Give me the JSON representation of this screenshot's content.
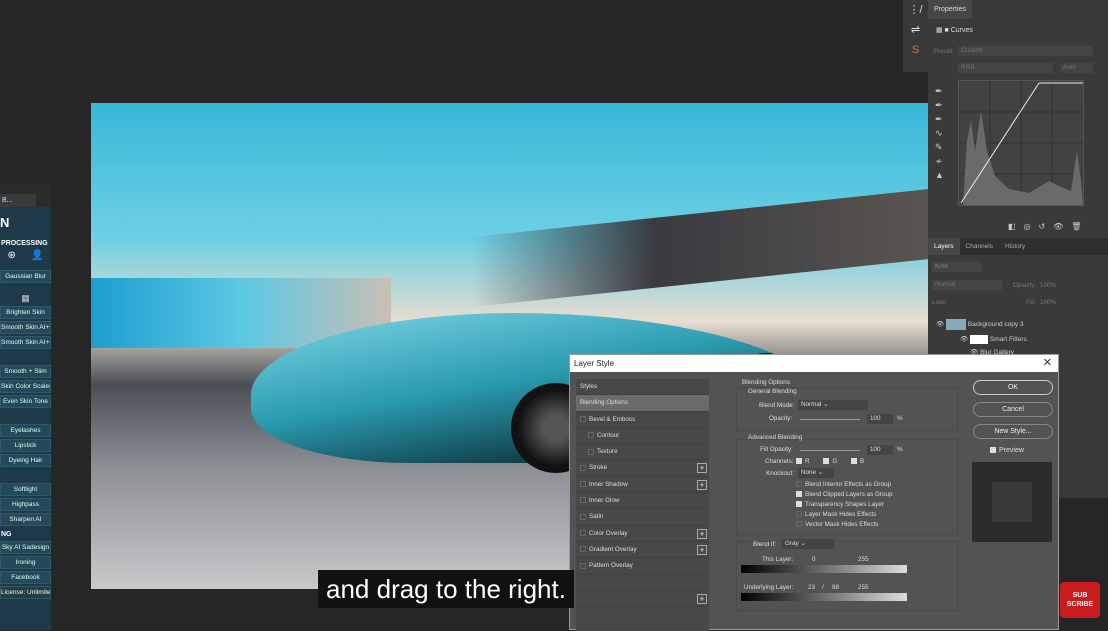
{
  "left_panel": {
    "tab": "B...",
    "logo": "N",
    "section1": "PROCESSING",
    "buttons1": [
      "Gaussian Blur"
    ],
    "buttons2": [
      "Brighten Skin",
      "Smooth Skin AI++",
      "Smooth Skin AI+++"
    ],
    "buttons3": [
      "Smooth + Slim",
      "Skin Color Scales",
      "Even Skin Tone"
    ],
    "buttons4": [
      "Eyelashes",
      "Lipstick",
      "Dyeing Hair"
    ],
    "buttons5": [
      "Softlight",
      "Highpass",
      "Sharpen AI"
    ],
    "section2": "NG",
    "buttons6": [
      "Sky AI Sadesign",
      "Ironing",
      "Facebook"
    ],
    "license": "License: Unlimited"
  },
  "properties": {
    "tab": "Properties",
    "title": "Curves",
    "preset_label": "Preset:",
    "preset_value": "Custom",
    "channel": "RGB",
    "auto": "Auto"
  },
  "layers": {
    "tabs": [
      "Layers",
      "Channels",
      "History"
    ],
    "kind": "Kind",
    "blend": "Normal",
    "opacity_label": "Opacity:",
    "opacity": "100%",
    "lock_label": "Lock:",
    "fill_label": "Fill:",
    "fill": "100%",
    "items": [
      "Background copy 3",
      "Smart Filters",
      "Blur Gallery"
    ]
  },
  "dialog": {
    "title": "Layer Style",
    "styles_header": "Styles",
    "styles": [
      {
        "label": "Blending Options",
        "active": true
      },
      {
        "label": "Bevel & Emboss",
        "cb": true
      },
      {
        "label": "Contour",
        "cb": true,
        "indent": true
      },
      {
        "label": "Texture",
        "cb": true,
        "indent": true
      },
      {
        "label": "Stroke",
        "cb": true,
        "plus": true
      },
      {
        "label": "Inner Shadow",
        "cb": true,
        "plus": true
      },
      {
        "label": "Inner Glow",
        "cb": true
      },
      {
        "label": "Satin",
        "cb": true
      },
      {
        "label": "Color Overlay",
        "cb": true,
        "plus": true
      },
      {
        "label": "Gradient Overlay",
        "cb": true,
        "plus": true
      },
      {
        "label": "Pattern Overlay",
        "cb": true
      },
      {
        "label": "",
        "cb": false
      },
      {
        "label": "",
        "plus": true
      }
    ],
    "blending_options": "Blending Options",
    "general_blending": "General Blending",
    "blend_mode_label": "Blend Mode:",
    "blend_mode": "Normal",
    "opacity_label": "Opacity:",
    "opacity": "100",
    "pct": "%",
    "advanced_blending": "Advanced Blending",
    "fill_opacity_label": "Fill Opacity:",
    "fill_opacity": "100",
    "channels_label": "Channels:",
    "channels": [
      "R",
      "G",
      "B"
    ],
    "knockout_label": "Knockout:",
    "knockout": "None",
    "options": [
      {
        "label": "Blend Interior Effects as Group",
        "checked": false
      },
      {
        "label": "Blend Clipped Layers as Group",
        "checked": true
      },
      {
        "label": "Transparency Shapes Layer",
        "checked": true
      },
      {
        "label": "Layer Mask Hides Effects",
        "checked": false
      },
      {
        "label": "Vector Mask Hides Effects",
        "checked": false
      }
    ],
    "blend_if_label": "Blend If:",
    "blend_if": "Gray",
    "this_layer_label": "This Layer:",
    "this_layer_low": "0",
    "this_layer_high": "255",
    "underlying_label": "Underlying Layer:",
    "underlying_low": "23",
    "underlying_sep": "/",
    "underlying_mid": "98",
    "underlying_high": "255",
    "ok": "OK",
    "cancel": "Cancel",
    "new_style": "New Style...",
    "preview": "Preview"
  },
  "subtitle": "and drag to the right.",
  "subscribe": "SUB SCRIBE"
}
